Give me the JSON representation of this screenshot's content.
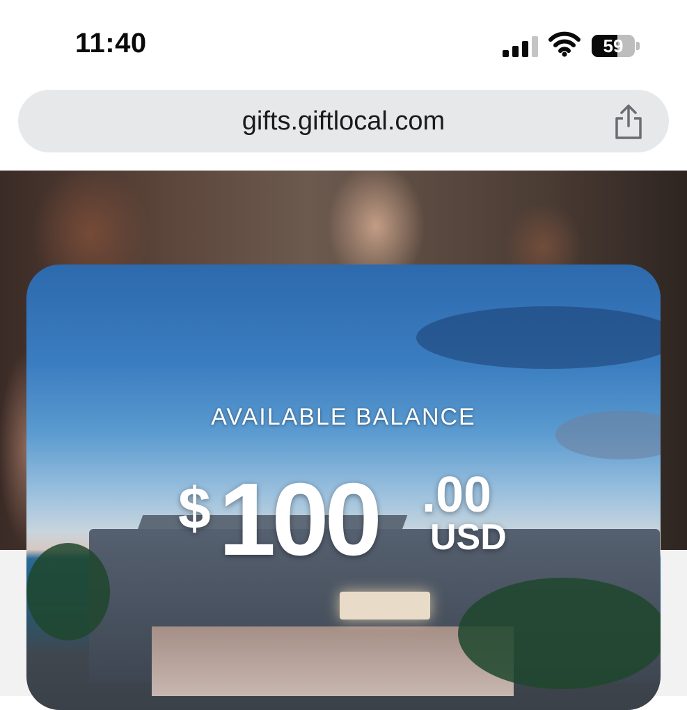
{
  "status_bar": {
    "time": "11:40",
    "battery_level": "59",
    "battery_fraction": 0.59
  },
  "browser": {
    "url": "gifts.giftlocal.com",
    "share_icon": "share-icon"
  },
  "gift_card": {
    "balance_label": "AVAILABLE BALANCE",
    "currency_symbol": "$",
    "amount_whole": "100",
    "amount_cents": ".00",
    "currency_code": "USD"
  },
  "icons": [
    "cellular-signal-icon",
    "wifi-icon",
    "battery-icon",
    "share-icon"
  ]
}
